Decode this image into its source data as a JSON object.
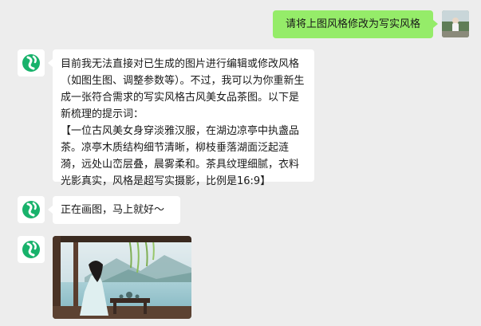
{
  "chat": {
    "user_message": "请将上图风格修改为写实风格",
    "bot_reply_1": {
      "intro": "目前我无法直接对已生成的图片进行编辑或修改风格（如图生图、调整参数等）。不过，我可以为你重新生成一张符合需求的写实风格古风美女品茶图。以下是新梳理的提示词：",
      "prompt": "【一位古风美女身穿淡雅汉服，在湖边凉亭中执盏品茶。凉亭木质结构细节清晰，柳枝垂落湖面泛起涟漪，远处山峦层叠，晨雾柔和。茶具纹理细腻，衣料光影真实，风格是超写实摄影，比例是16:9】"
    },
    "bot_reply_2": "正在画图，马上就好～"
  },
  "colors": {
    "background": "#ededed",
    "user_bubble": "#95ec69",
    "bot_bubble": "#ffffff",
    "bot_logo": "#18b26b"
  }
}
